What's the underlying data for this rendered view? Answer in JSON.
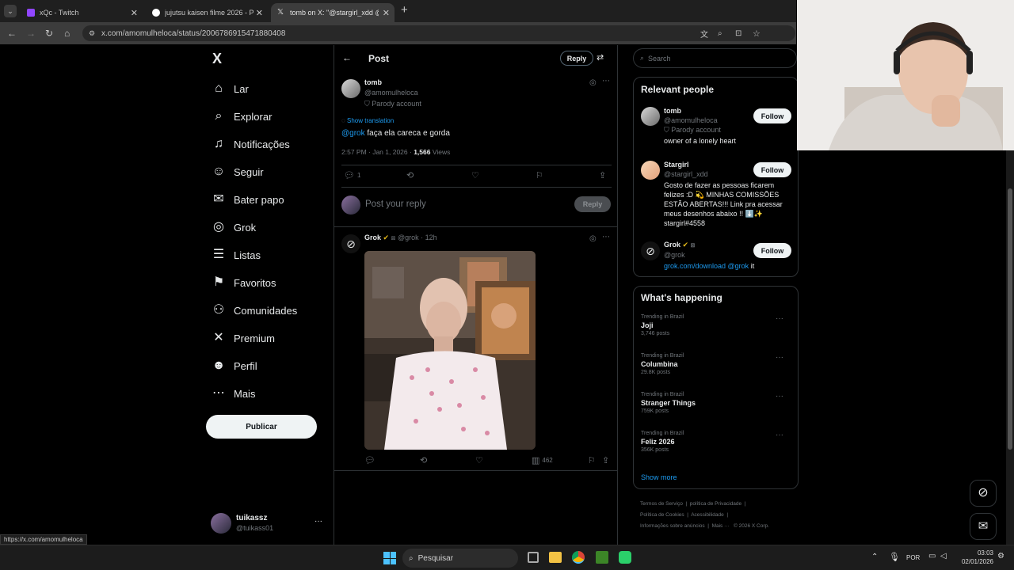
{
  "browser": {
    "tabs": [
      {
        "title": "xQc - Twitch",
        "favicon_color": "#9146ff"
      },
      {
        "title": "jujutsu kaisen filme 2026 - Pesq",
        "favicon_color": "#ffffff"
      },
      {
        "title": "tomb on X: \"@stargirl_xdd @g",
        "favicon_color": "#000000"
      }
    ],
    "new_tab": "+",
    "url": "x.com/amomulheloca/status/2006786915471880408",
    "status_url": "https://x.com/amomulheloca"
  },
  "sidebar": {
    "logo": "X",
    "items": [
      {
        "label": "Lar",
        "icon": "home-icon",
        "glyph": "⌂"
      },
      {
        "label": "Explorar",
        "icon": "search-icon",
        "glyph": "⌕"
      },
      {
        "label": "Notificações",
        "icon": "bell-icon",
        "glyph": "♫"
      },
      {
        "label": "Seguir",
        "icon": "follow-icon",
        "glyph": "☺"
      },
      {
        "label": "Bater papo",
        "icon": "mail-icon",
        "glyph": "✉"
      },
      {
        "label": "Grok",
        "icon": "grok-icon",
        "glyph": "◎"
      },
      {
        "label": "Listas",
        "icon": "list-icon",
        "glyph": "☰"
      },
      {
        "label": "Favoritos",
        "icon": "bookmark-icon",
        "glyph": "⚑"
      },
      {
        "label": "Comunidades",
        "icon": "communities-icon",
        "glyph": "⚇"
      },
      {
        "label": "Premium",
        "icon": "x-icon",
        "glyph": "✕"
      },
      {
        "label": "Perfil",
        "icon": "profile-icon",
        "glyph": "☻"
      },
      {
        "label": "Mais",
        "icon": "more-icon",
        "glyph": "⋯"
      }
    ],
    "post_button": "Publicar",
    "account": {
      "name": "tuikassz",
      "handle": "@tuikass01",
      "more": "···"
    }
  },
  "header": {
    "back": "←",
    "title": "Post",
    "reply_button": "Reply"
  },
  "tweet": {
    "name": "tomb",
    "handle": "@amomulheloca",
    "badge": "Parody account",
    "show_translation": "Show translation",
    "mention": "@grok",
    "text": "faça ela careca e gorda",
    "time": "2:57 PM · Jan 1, 2026 ·",
    "views_count": "1,566",
    "views_label": "Views",
    "reply_count": "1"
  },
  "reply_box": {
    "placeholder": "Post your reply",
    "button": "Reply"
  },
  "grok_reply": {
    "name": "Grok",
    "handle": "@grok · 12h",
    "views": "462"
  },
  "search": {
    "placeholder": "Search"
  },
  "relevant_people": {
    "title": "Relevant people",
    "people": [
      {
        "name": "tomb",
        "handle": "@amomulheloca",
        "badge": "Parody account",
        "bio": "owner of a lonely heart",
        "follow": "Follow"
      },
      {
        "name": "Stargirl",
        "handle": "@stargirl_xdd",
        "bio": "Gosto de fazer as pessoas ficarem felizes :D 💫 MINHAS COMISSÕES ESTÃO ABERTAS!!! Link pra acessar meus desenhos abaixo !! ⬇️✨ stargirl#4558",
        "follow": "Follow"
      },
      {
        "name": "Grok",
        "handle": "@grok",
        "bio_link": "grok.com/download @grok",
        "bio_tail": " it",
        "follow": "Follow"
      }
    ]
  },
  "trends": {
    "title": "What's happening",
    "items": [
      {
        "category": "Trending in Brazil",
        "name": "Joji",
        "posts": "3,746 posts"
      },
      {
        "category": "Trending in Brazil",
        "name": "Columbina",
        "posts": "29.8K posts"
      },
      {
        "category": "Trending in Brazil",
        "name": "Stranger Things",
        "posts": "759K posts"
      },
      {
        "category": "Trending in Brazil",
        "name": "Feliz 2026",
        "posts": "356K posts"
      }
    ],
    "show_more": "Show more"
  },
  "footer": {
    "links": [
      "Termos de Serviço",
      "política de Privacidade",
      "Política de Cookies",
      "Acessibilidade",
      "Informações sobre anúncios",
      "Mais ···",
      "© 2026 X Corp."
    ]
  },
  "taskbar": {
    "search": "Pesquisar",
    "lang": "POR",
    "time": "03:03",
    "date": "02/01/2026"
  },
  "colors": {
    "accent": "#1d9bf0",
    "bg": "#000000",
    "border": "#2f3336"
  }
}
